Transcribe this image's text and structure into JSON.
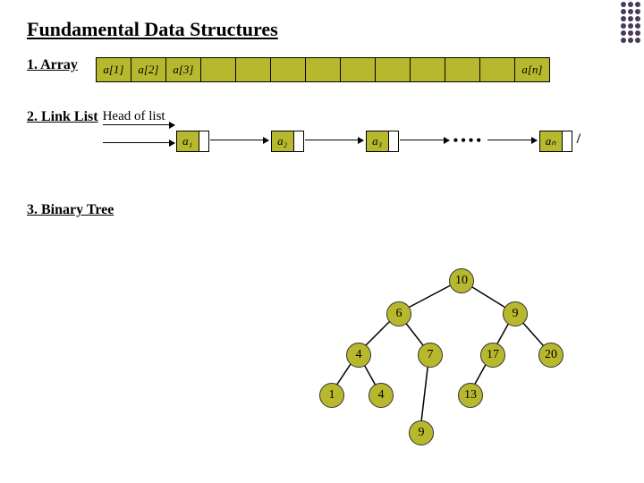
{
  "title": "Fundamental Data Structures",
  "sections": {
    "array": {
      "label": "1. Array"
    },
    "linklist": {
      "label": "2. Link List",
      "head": "Head of list"
    },
    "tree": {
      "label": "3. Binary Tree"
    }
  },
  "array_cells": {
    "c0": "a[1]",
    "c1": "a[2]",
    "c2": "a[3]",
    "c12": "a[n]"
  },
  "ll_nodes": {
    "n1": "a₁",
    "n2": "a₂",
    "n3": "a₃",
    "n4": "aₙ",
    "dots": "••••",
    "term": "/"
  },
  "tree": {
    "n10": "10",
    "n6": "6",
    "n9r": "9",
    "n4": "4",
    "n7": "7",
    "n17": "17",
    "n20": "20",
    "n1": "1",
    "n4b": "4",
    "n13": "13",
    "n9b": "9"
  }
}
